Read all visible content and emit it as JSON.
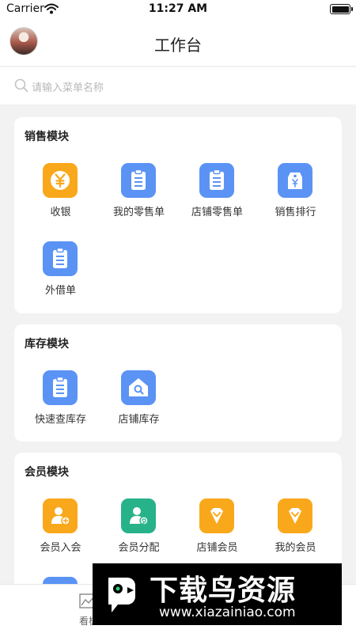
{
  "status_bar": {
    "carrier": "Carrier",
    "time": "11:27 AM"
  },
  "nav": {
    "title": "工作台"
  },
  "search": {
    "placeholder": "请输入菜单名称"
  },
  "colors": {
    "orange": "#F9A81B",
    "blue": "#5B93F5",
    "green": "#27B28A",
    "background": "#F2F2F2"
  },
  "sections": [
    {
      "title": "销售模块",
      "items": [
        {
          "label": "收银",
          "icon": "yen-coin-icon"
        },
        {
          "label": "我的零售单",
          "icon": "clipboard-icon"
        },
        {
          "label": "店铺零售单",
          "icon": "clipboard-icon"
        },
        {
          "label": "销售排行",
          "icon": "price-tag-icon"
        },
        {
          "label": "外借单",
          "icon": "clipboard-icon"
        }
      ]
    },
    {
      "title": "库存模块",
      "items": [
        {
          "label": "快速查库存",
          "icon": "clipboard-icon"
        },
        {
          "label": "店铺库存",
          "icon": "house-search-icon"
        }
      ]
    },
    {
      "title": "会员模块",
      "items": [
        {
          "label": "会员入会",
          "icon": "user-add-icon"
        },
        {
          "label": "会员分配",
          "icon": "user-assign-icon"
        },
        {
          "label": "店铺会员",
          "icon": "diamond-icon"
        },
        {
          "label": "我的会员",
          "icon": "diamond-icon"
        }
      ]
    }
  ],
  "tabbar": {
    "tab_label": "看板"
  },
  "watermark": {
    "title": "下载鸟资源",
    "url": "www.xiazainiao.com"
  }
}
